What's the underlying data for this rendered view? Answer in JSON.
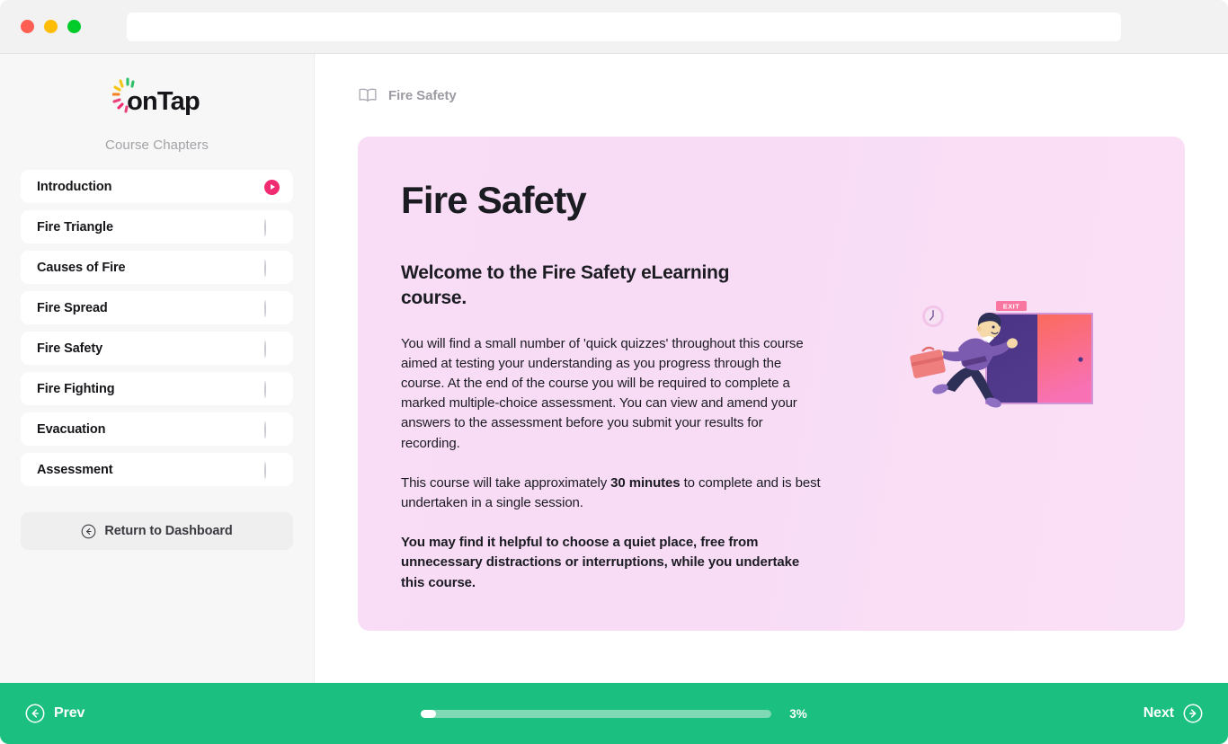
{
  "browser": {
    "traffic_lights": [
      "close",
      "minimize",
      "maximize"
    ],
    "url_value": "",
    "url_placeholder": ""
  },
  "sidebar": {
    "logo_text": "onTap",
    "logo_ray_colors": [
      "#2fc06a",
      "#f5c518",
      "#f58220",
      "#e8437d",
      "#f02b71",
      "#2fc06a"
    ],
    "chapters_label": "Course Chapters",
    "items": [
      {
        "label": "Introduction",
        "status": "playing"
      },
      {
        "label": "Fire Triangle",
        "status": "pending"
      },
      {
        "label": "Causes of Fire",
        "status": "pending"
      },
      {
        "label": "Fire Spread",
        "status": "pending"
      },
      {
        "label": "Fire Safety",
        "status": "pending"
      },
      {
        "label": "Fire Fighting",
        "status": "pending"
      },
      {
        "label": "Evacuation",
        "status": "pending"
      },
      {
        "label": "Assessment",
        "status": "pending"
      }
    ],
    "return_button": {
      "label": "Return to Dashboard",
      "icon": "arrow-left-circle-icon"
    }
  },
  "breadcrumb": {
    "icon": "open-book-icon",
    "label": "Fire Safety"
  },
  "hero": {
    "title": "Fire Safety",
    "subtitle": "Welcome to the Fire Safety eLearning course.",
    "paragraph_1": "You will find a small number of 'quick quizzes' throughout this course aimed at testing your understanding as you progress through the course. At the end of the course you will be required to complete a marked multiple-choice assessment. You can view and amend your answers to the assessment before you submit your results for recording.",
    "paragraph_2_before": "This course will take approximately ",
    "paragraph_2_bold": "30 minutes",
    "paragraph_2_after": " to complete and is best undertaken in a single session.",
    "paragraph_3": "You may find it helpful to choose a quiet place, free from unnecessary distractions or interruptions, while you undertake this course.",
    "background_color": "#f8dcf5"
  },
  "illustration": {
    "name": "man-running-to-exit-door",
    "exit_sign_label": "EXIT",
    "colors": {
      "door_left_panel": "#4b3485",
      "door_right_top": "#fb6a5c",
      "door_right_bottom": "#f871b4",
      "exit_sign": "#f8769f",
      "jacket": "#7a5bb0",
      "trousers": "#2f3057",
      "briefcase": "#ef7f7f",
      "clock": "#f2c4e9"
    }
  },
  "bottom_bar": {
    "background_color": "#1bbf7f",
    "prev": {
      "label": "Prev",
      "icon": "arrow-left-circle-icon"
    },
    "next": {
      "label": "Next",
      "icon": "arrow-right-circle-icon"
    },
    "progress_percent_label": "3%",
    "progress_percent_value": 3
  }
}
